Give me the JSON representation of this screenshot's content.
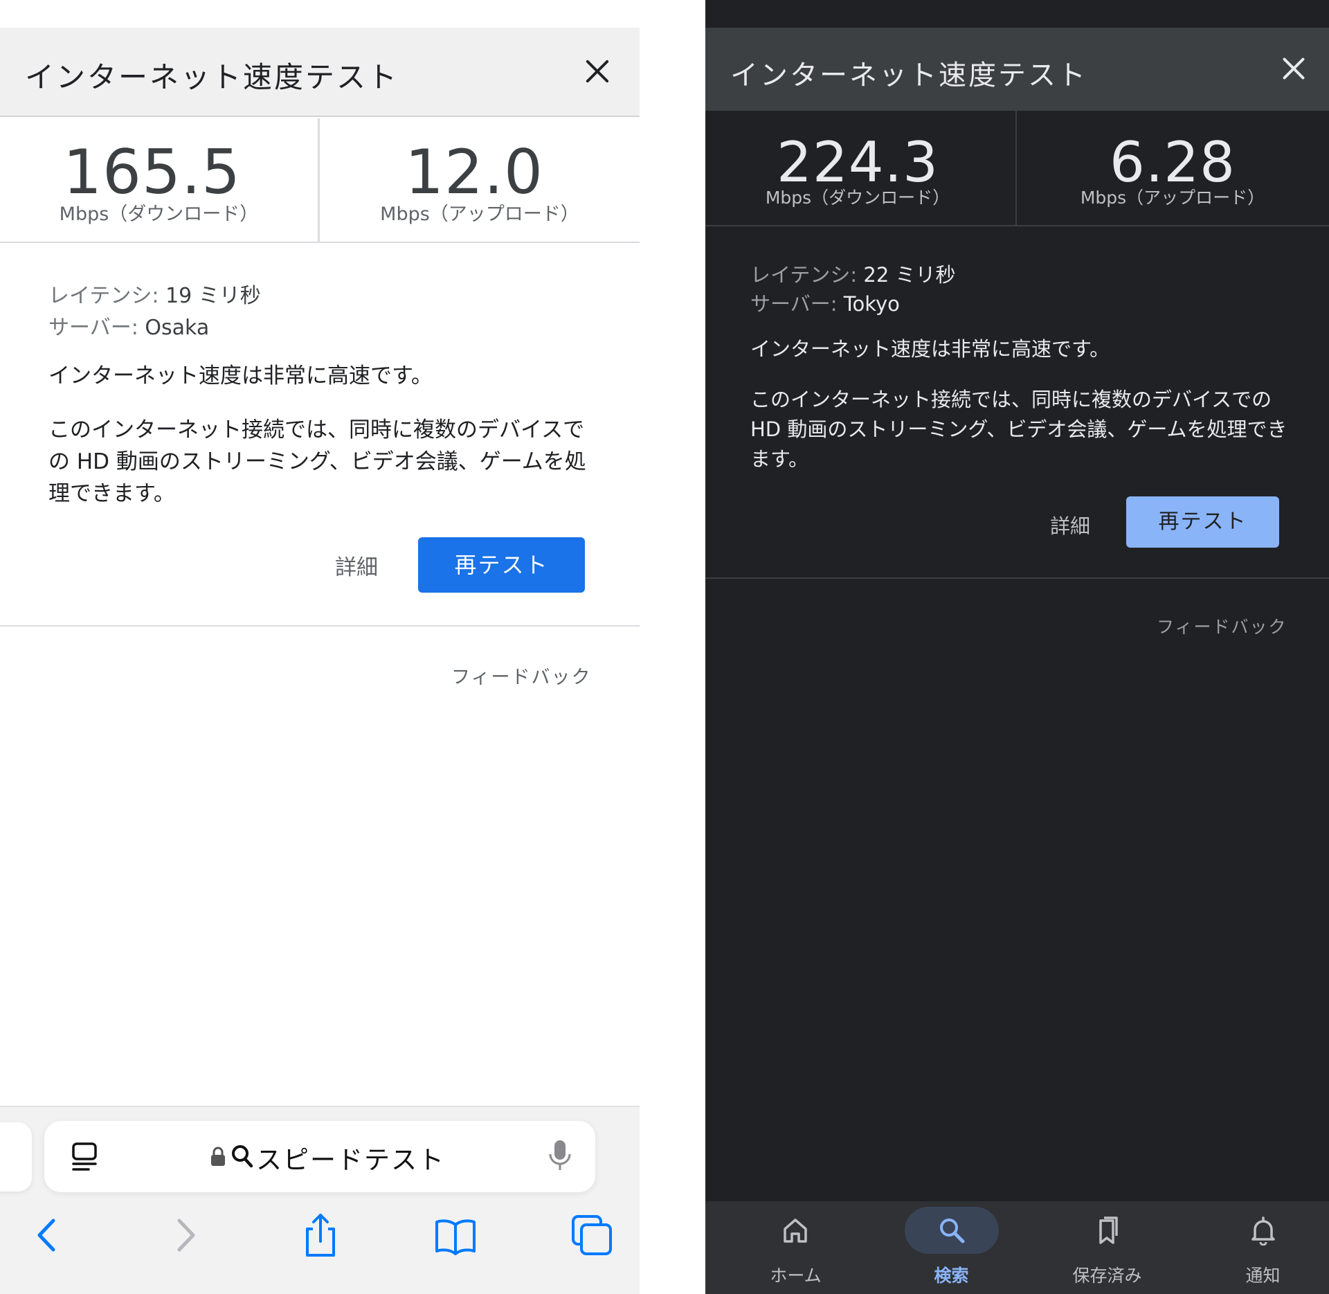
{
  "light": {
    "title": "インターネット速度テスト",
    "download_value": "165.5",
    "download_unit": "Mbps（ダウンロード）",
    "upload_value": "12.0",
    "upload_unit": "Mbps（アップロード）",
    "latency_label": "レイテンシ:",
    "latency_value": "19 ミリ秒",
    "server_label": "サーバー:",
    "server_value": "Osaka",
    "summary": "インターネット速度は非常に高速です。",
    "description": "このインターネット接続では、同時に複数のデバイスでの HD 動画のストリーミング、ビデオ会議、ゲームを処理できます。",
    "detail_label": "詳細",
    "retest_label": "再テスト",
    "feedback_label": "フィードバック",
    "url_text": "スピードテスト"
  },
  "dark": {
    "title": "インターネット速度テスト",
    "download_value": "224.3",
    "download_unit": "Mbps（ダウンロード）",
    "upload_value": "6.28",
    "upload_unit": "Mbps（アップロード）",
    "latency_label": "レイテンシ:",
    "latency_value": "22 ミリ秒",
    "server_label": "サーバー:",
    "server_value": "Tokyo",
    "summary": "インターネット速度は非常に高速です。",
    "description": "このインターネット接続では、同時に複数のデバイスでの HD 動画のストリーミング、ビデオ会議、ゲームを処理できます。",
    "detail_label": "詳細",
    "retest_label": "再テスト",
    "feedback_label": "フィードバック",
    "nav": [
      {
        "label": "ホーム",
        "icon": "home-icon",
        "active": false
      },
      {
        "label": "検索",
        "icon": "search-icon",
        "active": true
      },
      {
        "label": "保存済み",
        "icon": "bookmarks-icon",
        "active": false
      },
      {
        "label": "通知",
        "icon": "bell-icon",
        "active": false
      }
    ]
  },
  "colors": {
    "light_accent": "#1a73e8",
    "dark_accent": "#8ab4f8",
    "dark_bg": "#202124",
    "ios_blue": "#007aff"
  }
}
